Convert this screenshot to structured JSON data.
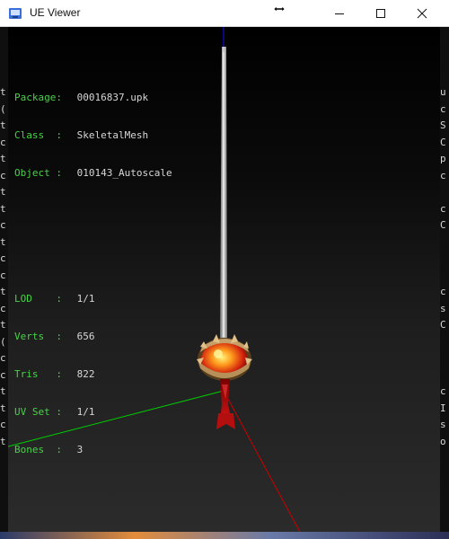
{
  "window": {
    "title": "UE Viewer"
  },
  "controls": {
    "minimize": "minimize",
    "maximize": "maximize",
    "close": "close"
  },
  "info": {
    "object_rows": [
      {
        "label": "Package:",
        "value": "00016837.upk"
      },
      {
        "label": "Class  :",
        "value": "SkeletalMesh"
      },
      {
        "label": "Object :",
        "value": "010143_Autoscale"
      }
    ],
    "mesh_rows": [
      {
        "label": "LOD    :",
        "value": "1/1"
      },
      {
        "label": "Verts  :",
        "value": "656"
      },
      {
        "label": "Tris   :",
        "value": "822"
      },
      {
        "label": "UV Set :",
        "value": "1/1"
      },
      {
        "label": "Bones  :",
        "value": "3"
      }
    ]
  },
  "background_fragments": {
    "left": [
      "t",
      "(",
      "t",
      "c",
      "t",
      "c",
      "t",
      "t",
      "c",
      "t",
      "c",
      "c",
      "t",
      "c",
      "t",
      "(",
      "c",
      "c",
      "t",
      "t",
      "c",
      "t"
    ],
    "right": [
      "u",
      "c",
      "S",
      "C",
      "p",
      "c",
      "",
      "c",
      "C",
      "",
      "",
      "",
      "c",
      "s",
      "C",
      "",
      "",
      "",
      "c",
      "I",
      "s",
      "o"
    ]
  },
  "colors": {
    "label_green": "#45d445",
    "text_light": "#d7d7d7",
    "axis_x": "#cc0000",
    "axis_y": "#00d000",
    "axis_z": "#1010ff"
  }
}
